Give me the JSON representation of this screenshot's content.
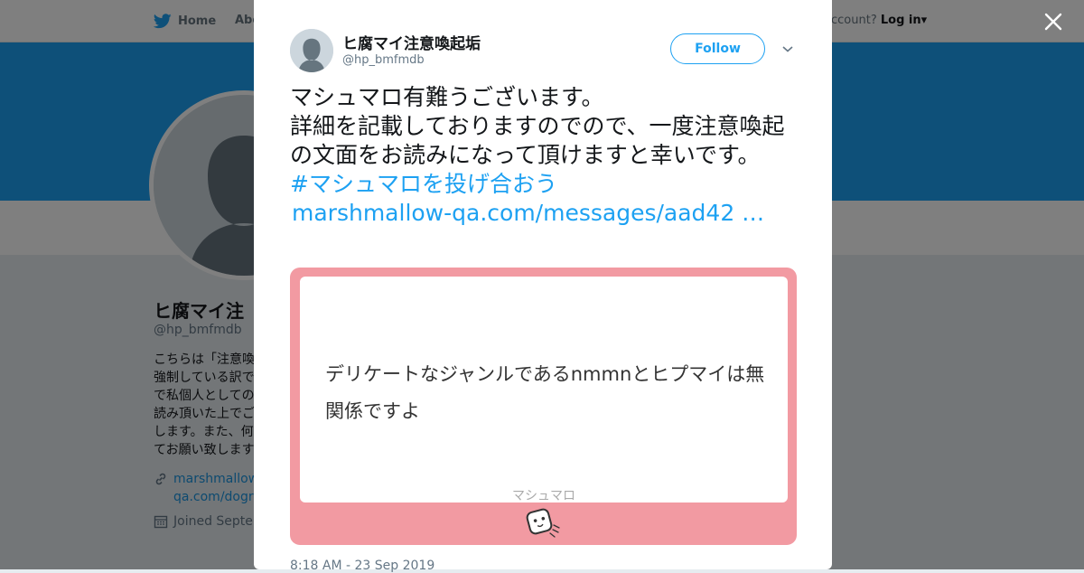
{
  "colors": {
    "accent": "#1da1f2",
    "card_bg": "#f29aa2",
    "banner": "#1da1f2"
  },
  "nav": {
    "home": "Home",
    "about": "Abo",
    "account_prompt": "ccount?",
    "login": "Log in"
  },
  "profile": {
    "name": "ヒ腐マイ注",
    "handle": "@hp_bmfmdb",
    "bio": "こちらは「注意喚\n強制している訳で\nで私個人としての\n読み頂いた上でご\nします。また、何\nてお願い致します",
    "link": "marshmallow-\nqa.com/dogra",
    "joined": "Joined Septen"
  },
  "tweet": {
    "name": "ヒ腐マイ注意喚起垢",
    "handle": "@hp_bmfmdb",
    "follow_label": "Follow",
    "text_lines": [
      "マシュマロ有難うございます。",
      "詳細を記載しておりますのでので、一度注意喚起の文面をお読みになって頂けますと幸いです。"
    ],
    "hashtag": "#マシュマロを投げ合おう",
    "url": "marshmallow-qa.com/messages/aad42 …",
    "card": {
      "question": "デリケートなジャンルであるnmmnとヒプマイは無関係ですよ",
      "brand": "マシュマロ"
    },
    "timestamp": "8:18 AM - 23 Sep 2019"
  },
  "icons": {
    "nav_home": "twitter-bird-icon",
    "close": "close-icon",
    "caret": "chevron-down-icon",
    "link": "link-icon",
    "calendar": "calendar-icon",
    "mascot": "marshmallow-mascot-icon"
  }
}
